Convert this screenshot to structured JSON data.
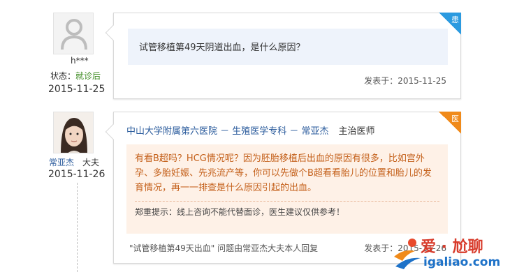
{
  "patient": {
    "name": "h***",
    "status_label": "状态：",
    "status_value": "就诊后",
    "date": "2015-11-25",
    "badge": "患",
    "question": "试管移植第49天阴道出血，是什么原因？",
    "posted": "发表于：2015-11-25"
  },
  "doctor": {
    "name": "常亚杰",
    "title_short": "大夫",
    "date": "2015-11-26",
    "badge": "医",
    "affiliation": "中山大学附属第六医院 － 生殖医学专科 － 常亚杰",
    "title": "主治医师",
    "answer": "有看B超吗？HCG情况呢？因为胚胎移植后出血的原因有很多，比如宫外孕、多胎妊娠、先兆流产等，你可以先做个B超看看胎儿的位置和胎儿的发育情况，再一一排查是什么原因引起的出血。",
    "tip": "郑重提示：线上咨询不能代替面诊，医生建议仅供参考！",
    "footer": "\"试管移植第49天出血\" 问题由常亚杰大夫本人回复",
    "posted": "发表于：2015-11-26"
  },
  "watermark": {
    "text": "爱 · 尬聊",
    "url": "igaliao.com"
  },
  "colors": {
    "link": "#2a5b9c",
    "answer_text": "#c4601a",
    "answer_bg": "#fef1e7",
    "question_bg": "#eef3fb",
    "patient_badge": "#2b9ae0",
    "doctor_badge": "#f08a1a",
    "status_green": "#3d8b21"
  },
  "icons": [
    "user-placeholder-icon",
    "doctor-photo"
  ]
}
